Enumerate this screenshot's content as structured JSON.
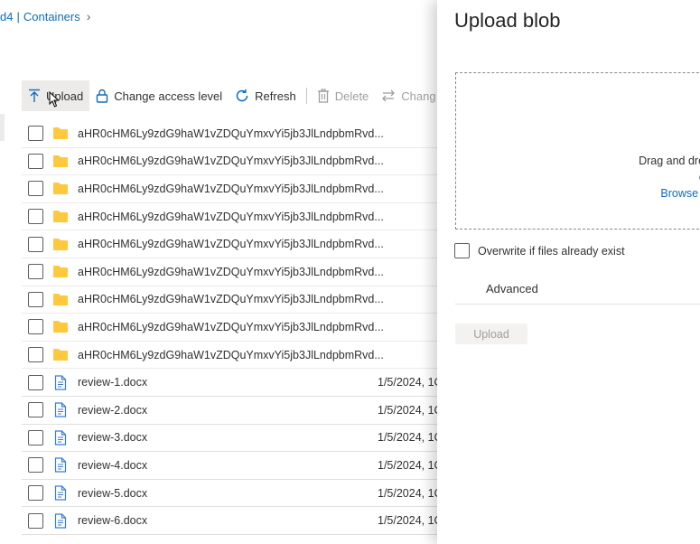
{
  "breadcrumb": {
    "prefix": "d4",
    "separator": "|",
    "current": "Containers",
    "chevron": "›"
  },
  "toolbar": {
    "upload_label": "Upload",
    "change_access_label": "Change access level",
    "refresh_label": "Refresh",
    "delete_label": "Delete",
    "change_tier_label": "Chang"
  },
  "rows": [
    {
      "type": "folder",
      "name": "aHR0cHM6Ly9zdG9haW1vZDQuYmxvYi5jb3JlLndpbmRvd..."
    },
    {
      "type": "folder",
      "name": "aHR0cHM6Ly9zdG9haW1vZDQuYmxvYi5jb3JlLndpbmRvd..."
    },
    {
      "type": "folder",
      "name": "aHR0cHM6Ly9zdG9haW1vZDQuYmxvYi5jb3JlLndpbmRvd..."
    },
    {
      "type": "folder",
      "name": "aHR0cHM6Ly9zdG9haW1vZDQuYmxvYi5jb3JlLndpbmRvd..."
    },
    {
      "type": "folder",
      "name": "aHR0cHM6Ly9zdG9haW1vZDQuYmxvYi5jb3JlLndpbmRvd..."
    },
    {
      "type": "folder",
      "name": "aHR0cHM6Ly9zdG9haW1vZDQuYmxvYi5jb3JlLndpbmRvd..."
    },
    {
      "type": "folder",
      "name": "aHR0cHM6Ly9zdG9haW1vZDQuYmxvYi5jb3JlLndpbmRvd..."
    },
    {
      "type": "folder",
      "name": "aHR0cHM6Ly9zdG9haW1vZDQuYmxvYi5jb3JlLndpbmRvd..."
    },
    {
      "type": "folder",
      "name": "aHR0cHM6Ly9zdG9haW1vZDQuYmxvYi5jb3JlLndpbmRvd..."
    },
    {
      "type": "file",
      "name": "review-1.docx",
      "modified": "1/5/2024, 1C"
    },
    {
      "type": "file",
      "name": "review-2.docx",
      "modified": "1/5/2024, 1C"
    },
    {
      "type": "file",
      "name": "review-3.docx",
      "modified": "1/5/2024, 1C"
    },
    {
      "type": "file",
      "name": "review-4.docx",
      "modified": "1/5/2024, 1C"
    },
    {
      "type": "file",
      "name": "review-5.docx",
      "modified": "1/5/2024, 1C"
    },
    {
      "type": "file",
      "name": "review-6.docx",
      "modified": "1/5/2024, 1C"
    }
  ],
  "panel": {
    "title": "Upload blob",
    "drag_text": "Drag and drop",
    "or_text": "or",
    "browse_text": "Browse fo",
    "overwrite_label": "Overwrite if files already exist",
    "advanced_label": "Advanced",
    "upload_button": "Upload"
  },
  "colors": {
    "folder": "#ffc83d",
    "link": "#0f6cbd",
    "doc_icon": "#3a7bd5"
  },
  "icons": [
    "upload-icon",
    "lock-icon",
    "refresh-icon",
    "trash-icon",
    "swap-arrows-icon",
    "folder-icon",
    "document-icon",
    "pointer-cursor-icon"
  ]
}
